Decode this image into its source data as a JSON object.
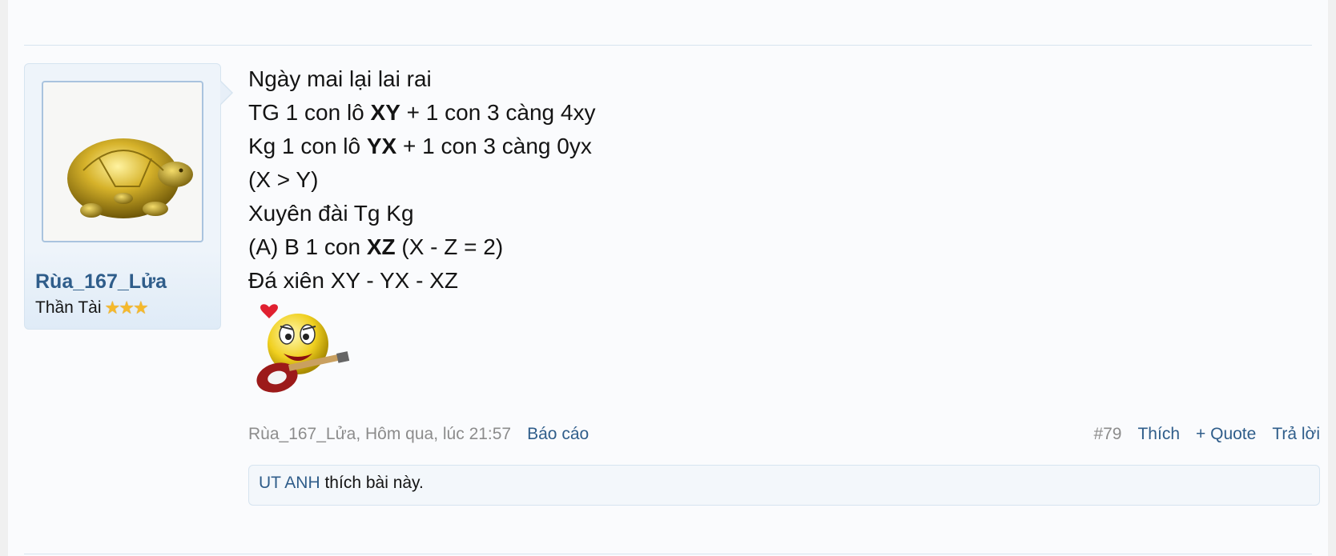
{
  "user": {
    "name": "Rùa_167_Lửa",
    "title": "Thần Tài",
    "stars": [
      "★",
      "★",
      "★"
    ],
    "avatar_icon": "golden-turtle-icon"
  },
  "post": {
    "lines": [
      {
        "pre": "Ngày mai lại lai rai",
        "bold": "",
        "post": ""
      },
      {
        "pre": "TG 1 con lô ",
        "bold": "XY",
        "post": " + 1 con 3 càng 4xy"
      },
      {
        "pre": "Kg 1 con lô ",
        "bold": "YX",
        "post": " + 1 con 3 càng 0yx"
      },
      {
        "pre": "(X > Y)",
        "bold": "",
        "post": ""
      },
      {
        "pre": "Xuyên đài Tg Kg",
        "bold": "",
        "post": ""
      },
      {
        "pre": "(A) B 1 con ",
        "bold": "XZ",
        "post": " (X - Z = 2)"
      },
      {
        "pre": "Đá xiên XY - YX - XZ",
        "bold": "",
        "post": ""
      }
    ],
    "smiley_icon": "guitar-smiley-icon"
  },
  "meta": {
    "author_time": "Rùa_167_Lửa, Hôm qua, lúc 21:57",
    "report": "Báo cáo",
    "post_number": "#79",
    "like": "Thích",
    "quote": "+ Quote",
    "reply": "Trả lời"
  },
  "likes": {
    "user": "UT ANH",
    "text": " thích bài này."
  },
  "colors": {
    "link": "#2f5d8a",
    "muted": "#8c8c8c",
    "border": "#d6e4f0"
  }
}
